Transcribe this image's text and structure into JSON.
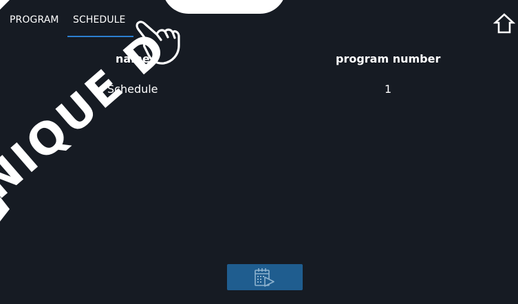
{
  "tabs": [
    {
      "label": "PROGRAM",
      "active": false
    },
    {
      "label": "SCHEDULE",
      "active": true
    }
  ],
  "table": {
    "headers": {
      "name": "name",
      "program_number": "program number"
    },
    "rows": [
      {
        "name": "Schedule",
        "program_number": "1"
      }
    ]
  },
  "icons": {
    "home": "home-icon",
    "run_schedule": "calendar-play-icon",
    "pointer": "pointing-hand-icon"
  },
  "watermark": {
    "text": "NIQUE D"
  },
  "colors": {
    "background": "#161b23",
    "accent": "#2c7fd1",
    "button": "#1f5d8f",
    "text": "#ffffff"
  }
}
